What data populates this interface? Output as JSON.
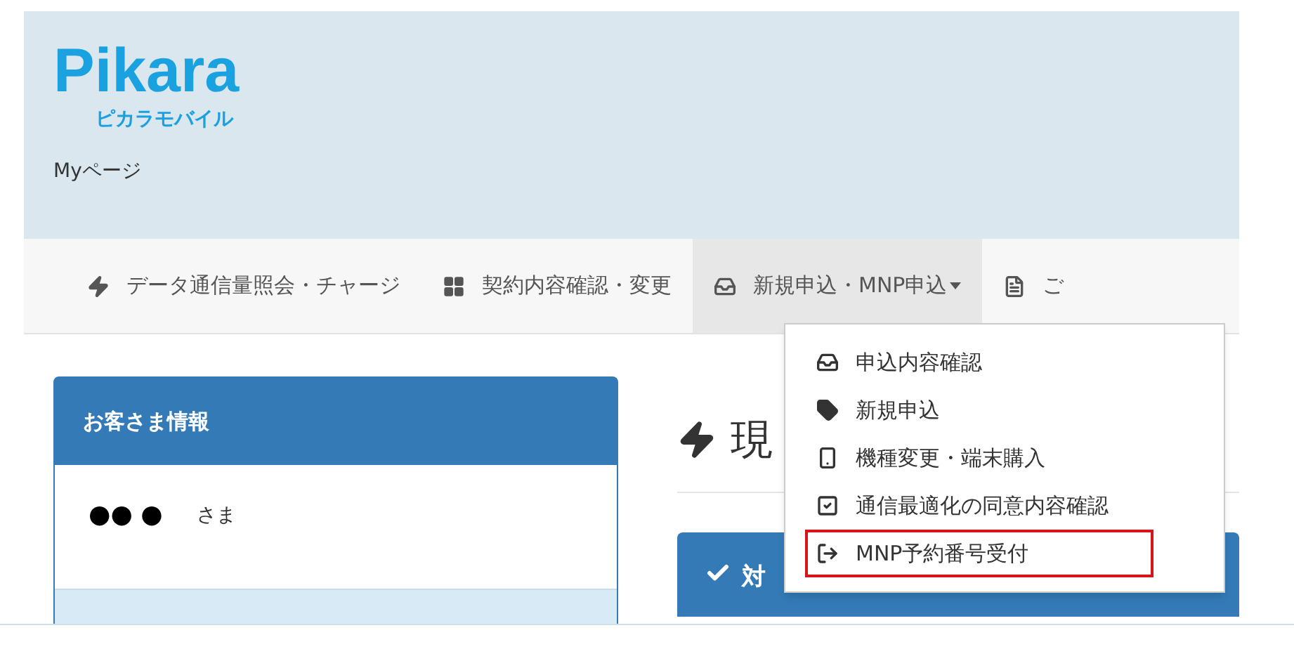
{
  "header": {
    "logo": "Pikara",
    "logo_sub": "ピカラモバイル",
    "page_title": "Myページ"
  },
  "nav": [
    {
      "kind": "bolt",
      "label": "データ通信量照会・チャージ",
      "selected": false,
      "has_dropdown": false
    },
    {
      "kind": "grid",
      "label": "契約内容確認・変更",
      "selected": false,
      "has_dropdown": false
    },
    {
      "kind": "inbox",
      "label": "新規申込・MNP申込",
      "selected": true,
      "has_dropdown": true
    },
    {
      "kind": "list",
      "label": "ご",
      "selected": false,
      "has_dropdown": false
    }
  ],
  "dropdown": [
    {
      "kind": "inbox",
      "label": "申込内容確認",
      "highlighted": false
    },
    {
      "kind": "tag",
      "label": "新規申込",
      "highlighted": false
    },
    {
      "kind": "phone",
      "label": "機種変更・端末購入",
      "highlighted": false
    },
    {
      "kind": "check",
      "label": "通信最適化の同意内容確認",
      "highlighted": false
    },
    {
      "kind": "signout",
      "label": "MNP予約番号受付",
      "highlighted": true
    }
  ],
  "customer_panel": {
    "title": "お客さま情報",
    "name": "●● ●",
    "honorific": "さま"
  },
  "main": {
    "heading": "現",
    "section_title": "対"
  }
}
